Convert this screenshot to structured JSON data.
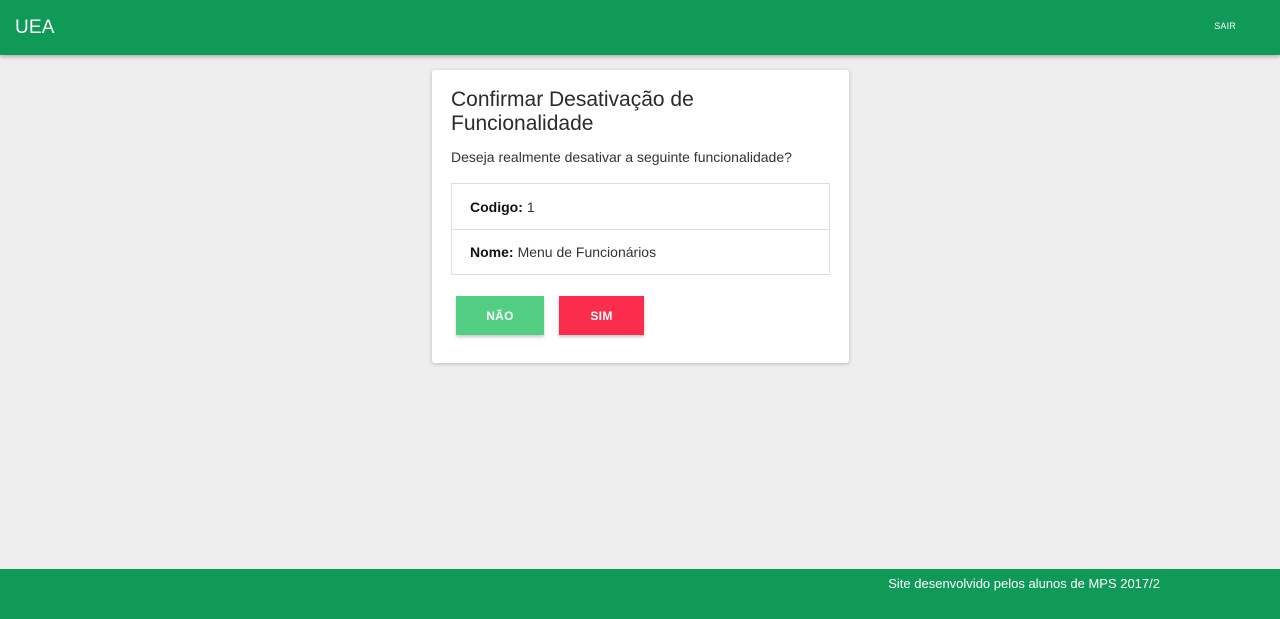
{
  "navbar": {
    "brand": "UEA",
    "logout_label": "SAIR"
  },
  "dialog": {
    "title": "Confirmar Desativação de Funcionalidade",
    "message": "Deseja realmente desativar a seguinte funcionalidade?",
    "fields": [
      {
        "label": "Codigo:",
        "value": "1"
      },
      {
        "label": "Nome:",
        "value": "Menu de Funcionários"
      }
    ],
    "no_label": "NÃO",
    "yes_label": "SIM"
  },
  "footer": {
    "text": "Site desenvolvido pelos alunos de MPS 2017/2"
  },
  "colors": {
    "primary": "#0f9a57",
    "no_button": "#52cf82",
    "yes_button": "#fc2c4d",
    "background": "#eeeeee"
  }
}
